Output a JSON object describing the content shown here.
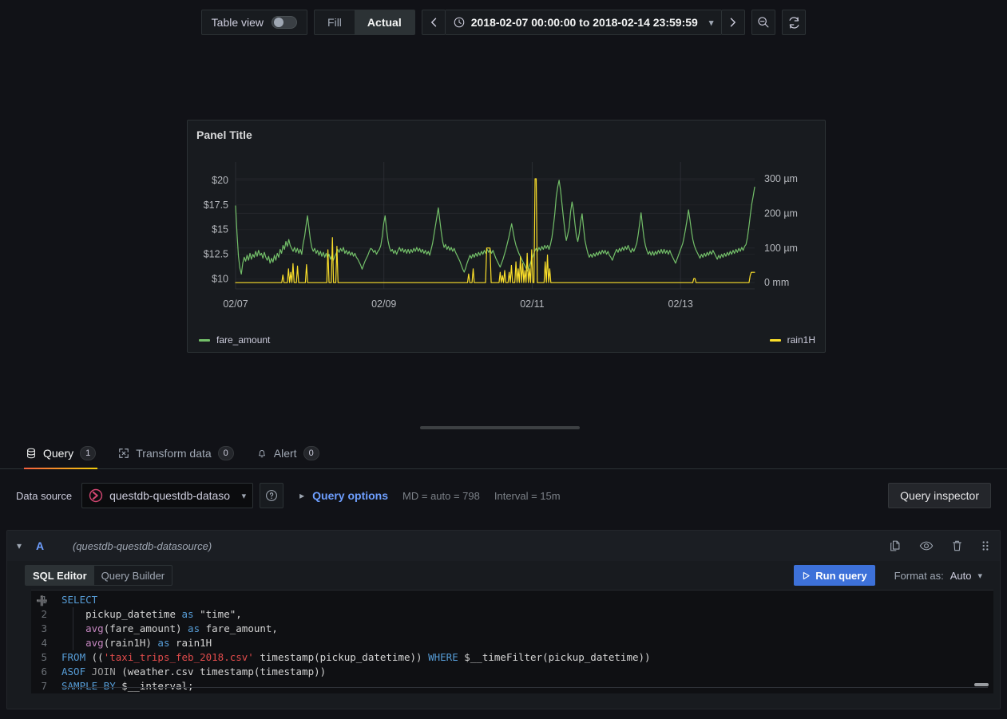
{
  "toolbar": {
    "table_view_label": "Table view",
    "table_view_on": false,
    "fill_label": "Fill",
    "actual_label": "Actual",
    "time_range": "2018-02-07 00:00:00 to 2018-02-14 23:59:59",
    "prev_icon": "chevron-left-icon",
    "next_icon": "chevron-right-icon",
    "clock_icon": "clock-icon",
    "zoom_out_icon": "zoom-out-icon",
    "refresh_icon": "refresh-icon"
  },
  "panel": {
    "title": "Panel Title",
    "legend": [
      {
        "label": "fare_amount",
        "color": "#73bf69"
      },
      {
        "label": "rain1H",
        "color": "#fade2a"
      }
    ]
  },
  "chart_data": {
    "type": "line",
    "title": "Panel Title",
    "xlabel": "",
    "grid": true,
    "legend_position": "bottom",
    "x_ticks": [
      "02/07",
      "02/09",
      "02/11",
      "02/13"
    ],
    "left_axis": {
      "label": "",
      "ticks": [
        "$10",
        "$12.5",
        "$15",
        "$17.5",
        "$20"
      ],
      "ylim": [
        9.0,
        21.2
      ],
      "unit": "USD"
    },
    "right_axis": {
      "label": "",
      "ticks": [
        "0 mm",
        "100 µm",
        "200 µm",
        "300 µm"
      ],
      "ylim": [
        -18,
        330
      ],
      "unit": "mm"
    },
    "series": [
      {
        "name": "fare_amount",
        "color": "#73bf69",
        "axis": "left",
        "values": [
          17.4,
          14.6,
          12.3,
          11.1,
          10.5,
          11.6,
          12.2,
          11.8,
          12.4,
          11.9,
          12.6,
          12.0,
          12.5,
          12.2,
          12.8,
          12.3,
          12.9,
          12.4,
          12.6,
          12.1,
          12.7,
          12.2,
          11.9,
          12.3,
          11.6,
          12.1,
          11.7,
          12.4,
          11.9,
          12.6,
          12.2,
          13.0,
          12.6,
          13.4,
          13.0,
          13.8,
          13.3,
          14.0,
          13.4,
          13.1,
          12.8,
          13.2,
          12.7,
          13.1,
          12.6,
          13.0,
          12.5,
          13.6,
          14.3,
          15.4,
          16.4,
          15.2,
          14.0,
          13.2,
          12.8,
          13.1,
          12.6,
          12.9,
          12.4,
          12.8,
          12.3,
          12.7,
          12.2,
          12.6,
          12.1,
          12.5,
          12.0,
          12.4,
          11.9,
          12.3,
          12.6,
          13.0,
          12.7,
          13.1,
          12.8,
          13.2,
          12.6,
          12.9,
          12.5,
          12.8,
          12.4,
          12.7,
          12.3,
          12.6,
          12.2,
          12.0,
          11.7,
          11.4,
          11.0,
          11.4,
          11.8,
          12.1,
          12.4,
          12.8,
          13.1,
          13.0,
          12.7,
          12.9,
          12.5,
          12.8,
          13.0,
          13.4,
          14.3,
          15.6,
          16.4,
          15.0,
          13.9,
          13.2,
          12.8,
          13.0,
          12.6,
          12.9,
          12.5,
          12.9,
          13.2,
          12.8,
          13.1,
          12.7,
          13.0,
          12.6,
          13.0,
          12.6,
          13.0,
          12.7,
          13.1,
          12.8,
          13.2,
          12.8,
          13.1,
          12.7,
          13.0,
          12.6,
          12.9,
          12.5,
          12.8,
          12.4,
          13.0,
          13.6,
          14.5,
          15.4,
          16.3,
          17.2,
          16.0,
          14.8,
          13.8,
          13.2,
          13.5,
          13.0,
          13.3,
          12.9,
          13.2,
          12.8,
          13.1,
          12.7,
          12.4,
          12.1,
          11.8,
          11.4,
          11.0,
          10.7,
          11.1,
          11.6,
          12.0,
          12.4,
          12.1,
          12.5,
          12.2,
          12.6,
          12.3,
          12.7,
          12.4,
          12.8,
          12.5,
          12.9,
          12.6,
          13.0,
          12.7,
          13.0,
          12.6,
          12.9,
          12.5,
          12.1,
          11.8,
          11.5,
          11.2,
          11.6,
          12.0,
          12.5,
          13.0,
          13.6,
          14.2,
          14.9,
          15.6,
          14.8,
          14.0,
          13.4,
          13.0,
          12.6,
          12.3,
          12.0,
          11.7,
          11.4,
          11.1,
          10.8,
          11.2,
          11.6,
          12.0,
          12.4,
          12.8,
          13.1,
          12.8,
          13.2,
          12.9,
          13.3,
          13.0,
          13.4,
          13.1,
          13.4,
          13.0,
          13.5,
          14.2,
          15.3,
          16.6,
          18.3,
          19.3,
          20.0,
          19.0,
          17.6,
          16.2,
          14.9,
          13.9,
          14.5,
          15.2,
          16.8,
          17.8,
          17.0,
          15.6,
          14.4,
          13.8,
          14.6,
          15.8,
          16.6,
          15.2,
          13.9,
          13.2,
          12.6,
          12.2,
          12.5,
          12.2,
          12.6,
          12.3,
          12.7,
          12.4,
          12.8,
          12.5,
          12.9,
          12.6,
          12.9,
          12.5,
          12.8,
          12.4,
          12.2,
          11.9,
          12.3,
          12.7,
          13.0,
          12.7,
          13.1,
          12.8,
          13.2,
          12.9,
          13.3,
          13.0,
          13.4,
          13.0,
          12.7,
          13.1,
          12.8,
          13.2,
          13.6,
          14.5,
          15.6,
          16.7,
          15.4,
          14.2,
          13.4,
          12.9,
          12.5,
          12.8,
          12.4,
          12.8,
          12.4,
          12.8,
          12.5,
          12.9,
          12.6,
          13.0,
          12.6,
          13.0,
          12.6,
          12.9,
          12.5,
          12.9,
          12.5,
          12.2,
          11.9,
          11.6,
          12.0,
          12.4,
          12.8,
          13.2,
          13.6,
          14.3,
          15.1,
          16.0,
          17.0,
          16.0,
          14.9,
          14.0,
          13.4,
          13.0,
          12.7,
          12.4,
          12.1,
          12.5,
          12.2,
          12.6,
          12.3,
          12.7,
          12.4,
          12.8,
          12.5,
          12.9,
          12.6,
          12.3,
          12.0,
          12.4,
          12.1,
          12.5,
          12.2,
          12.6,
          12.3,
          12.7,
          12.4,
          12.8,
          12.5,
          12.9,
          12.6,
          13.0,
          12.7,
          13.1,
          12.8,
          13.2,
          12.9,
          13.3,
          13.5,
          14.2,
          15.3,
          16.5,
          17.6,
          18.4,
          19.3
        ]
      },
      {
        "name": "rain1H",
        "color": "#fade2a",
        "axis": "right",
        "values": [
          0,
          0,
          0,
          0,
          0,
          0,
          0,
          0,
          0,
          0,
          0,
          0,
          0,
          0,
          0,
          0,
          0,
          0,
          0,
          0,
          0,
          0,
          0,
          0,
          0,
          0,
          0,
          0,
          0,
          0,
          0,
          0,
          0,
          0,
          0,
          0,
          0,
          0,
          0,
          0,
          0,
          0,
          22,
          0,
          0,
          0,
          0,
          40,
          0,
          30,
          0,
          55,
          0,
          0,
          0,
          48,
          0,
          0,
          0,
          0,
          0,
          0,
          0,
          52,
          0,
          0,
          0,
          0,
          0,
          0,
          0,
          0,
          0,
          0,
          0,
          0,
          0,
          0,
          0,
          0,
          0,
          0,
          95,
          0,
          0,
          0,
          130,
          0,
          0,
          0,
          105,
          0,
          0,
          0,
          0,
          0,
          0,
          0,
          0,
          0,
          0,
          0,
          0,
          0,
          0,
          0,
          0,
          0,
          0,
          0,
          0,
          0,
          0,
          0,
          0,
          0,
          0,
          0,
          0,
          0,
          0,
          0,
          0,
          0,
          0,
          0,
          0,
          0,
          0,
          0,
          0,
          0,
          0,
          0,
          0,
          0,
          0,
          0,
          0,
          0,
          0,
          0,
          0,
          0,
          0,
          0,
          0,
          0,
          0,
          0,
          0,
          0,
          0,
          0,
          0,
          0,
          0,
          0,
          0,
          0,
          0,
          0,
          0,
          0,
          0,
          0,
          0,
          0,
          0,
          0,
          0,
          0,
          0,
          0,
          0,
          0,
          0,
          0,
          0,
          0,
          0,
          0,
          0,
          0,
          0,
          0,
          0,
          0,
          0,
          0,
          0,
          0,
          0,
          0,
          0,
          0,
          0,
          0,
          0,
          0,
          0,
          0,
          0,
          0,
          0,
          0,
          0,
          25,
          0,
          0,
          0,
          40,
          0,
          0,
          0,
          0,
          0,
          0,
          0,
          0,
          0,
          0,
          0,
          100,
          100,
          100,
          100,
          0,
          0,
          0,
          0,
          0,
          0,
          0,
          0,
          30,
          0,
          20,
          0,
          35,
          0,
          0,
          0,
          30,
          0,
          50,
          0,
          0,
          0,
          60,
          0,
          40,
          0,
          75,
          0,
          55,
          0,
          35,
          0,
          85,
          0,
          40,
          0,
          95,
          0,
          0,
          300,
          300,
          0,
          0,
          0,
          0,
          0,
          0,
          0,
          60,
          0,
          80,
          0,
          40,
          0,
          0,
          0,
          0,
          0,
          0,
          0,
          0,
          0,
          0,
          0,
          0,
          0,
          0,
          0,
          0,
          0,
          0,
          0,
          0,
          0,
          0,
          0,
          0,
          0,
          0,
          0,
          0,
          0,
          0,
          0,
          0,
          0,
          0,
          0,
          0,
          0,
          0,
          0,
          0,
          0,
          0,
          0,
          0,
          0,
          0,
          0,
          0,
          0,
          0,
          0,
          0,
          0,
          0,
          0,
          0,
          0,
          0,
          0,
          0,
          0,
          0,
          0,
          0,
          0,
          0,
          0,
          0,
          0,
          0,
          0,
          0,
          0,
          0,
          0,
          0,
          0,
          0,
          0,
          0,
          0,
          0,
          0,
          0,
          0,
          0,
          0,
          0,
          0,
          0,
          0,
          0,
          0,
          0,
          0,
          0,
          0,
          0,
          0,
          0,
          0,
          0,
          0,
          0,
          0,
          0,
          0,
          0,
          0,
          0,
          0,
          0,
          0,
          0,
          0,
          0,
          0,
          0,
          0,
          0,
          0,
          0,
          0,
          0,
          0,
          0,
          0,
          12,
          12,
          0,
          0,
          0,
          0,
          0,
          0,
          0,
          0,
          0,
          0,
          0,
          0,
          0,
          0,
          0,
          0,
          0,
          0,
          0,
          0,
          0,
          0,
          0,
          0,
          0,
          0,
          0,
          0,
          0,
          0,
          0,
          0,
          0,
          0,
          0,
          0,
          0,
          0,
          0,
          0,
          0,
          0,
          0,
          0,
          0,
          0,
          0,
          0,
          20,
          30,
          30,
          30,
          30
        ]
      }
    ]
  },
  "tabs": [
    {
      "label": "Query",
      "count": "1",
      "icon": "database-icon",
      "active": true
    },
    {
      "label": "Transform data",
      "count": "0",
      "icon": "transform-icon",
      "active": false
    },
    {
      "label": "Alert",
      "count": "0",
      "icon": "bell-icon",
      "active": false
    }
  ],
  "datasource_row": {
    "label": "Data source",
    "selected": "questdb-questdb-dataso",
    "help_icon": "help-circle-icon",
    "query_options_label": "Query options",
    "md_text": "MD = auto = 798",
    "interval_text": "Interval = 15m",
    "query_inspector_label": "Query inspector"
  },
  "query": {
    "ref_id": "A",
    "datasource": "(questdb-questdb-datasource)",
    "actions": [
      {
        "name": "duplicate-query-icon"
      },
      {
        "name": "hide-query-icon"
      },
      {
        "name": "remove-query-icon"
      },
      {
        "name": "drag-query-icon"
      }
    ],
    "editor_modes": [
      {
        "label": "SQL Editor",
        "active": true
      },
      {
        "label": "Query Builder",
        "active": false
      }
    ],
    "run_label": "Run query",
    "format_label": "Format as:",
    "format_value": "Auto",
    "code_lines": [
      {
        "num": "1",
        "tokens": [
          {
            "t": "SELECT",
            "c": "k"
          }
        ]
      },
      {
        "num": "2",
        "tokens": [
          {
            "t": "    pickup_datetime ",
            "c": "pl"
          },
          {
            "t": "as",
            "c": "k"
          },
          {
            "t": " \"time\",",
            "c": "pl"
          }
        ]
      },
      {
        "num": "3",
        "tokens": [
          {
            "t": "    ",
            "c": "pl"
          },
          {
            "t": "avg",
            "c": "fn"
          },
          {
            "t": "(fare_amount) ",
            "c": "pl"
          },
          {
            "t": "as",
            "c": "k"
          },
          {
            "t": " fare_amount,",
            "c": "pl"
          }
        ]
      },
      {
        "num": "4",
        "tokens": [
          {
            "t": "    ",
            "c": "pl"
          },
          {
            "t": "avg",
            "c": "fn"
          },
          {
            "t": "(rain1H) ",
            "c": "pl"
          },
          {
            "t": "as",
            "c": "k"
          },
          {
            "t": " rain1H",
            "c": "pl"
          }
        ]
      },
      {
        "num": "5",
        "tokens": [
          {
            "t": "FROM",
            "c": "k"
          },
          {
            "t": " ((",
            "c": "pl"
          },
          {
            "t": "'taxi_trips_feb_2018.csv'",
            "c": "strred"
          },
          {
            "t": " timestamp(pickup_datetime)) ",
            "c": "pl"
          },
          {
            "t": "WHERE",
            "c": "k"
          },
          {
            "t": " $__timeFilter(pickup_datetime))",
            "c": "pl"
          }
        ]
      },
      {
        "num": "6",
        "tokens": [
          {
            "t": "ASOF",
            "c": "k"
          },
          {
            "t": " JOIN",
            "c": "dim"
          },
          {
            "t": " (weather.csv timestamp(timestamp))",
            "c": "pl"
          }
        ]
      },
      {
        "num": "7",
        "tokens": [
          {
            "t": "SAMPLE BY",
            "c": "k"
          },
          {
            "t": " $__interval;",
            "c": "pl"
          }
        ]
      }
    ]
  }
}
